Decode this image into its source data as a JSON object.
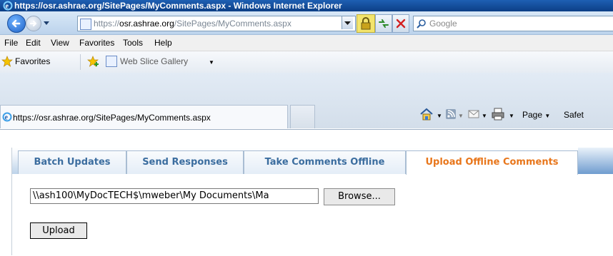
{
  "window": {
    "title": "https://osr.ashrae.org/SitePages/MyComments.aspx - Windows Internet Explorer"
  },
  "address_bar": {
    "url_prefix": "https://",
    "url_domain": "osr.ashrae.org",
    "url_path": "/SitePages/MyComments.aspx"
  },
  "search": {
    "placeholder": "Google"
  },
  "menu": {
    "items": [
      {
        "label": "File"
      },
      {
        "label": "Edit"
      },
      {
        "label": "View"
      },
      {
        "label": "Favorites"
      },
      {
        "label": "Tools"
      },
      {
        "label": "Help"
      }
    ]
  },
  "favorites_bar": {
    "favorites_label": "Favorites",
    "web_slice_label": "Web Slice Gallery"
  },
  "browser_tab": {
    "title": "https://osr.ashrae.org/SitePages/MyComments.aspx"
  },
  "command_bar": {
    "page_label": "Page",
    "safety_label": "Safet"
  },
  "page": {
    "tabs": [
      {
        "label": "Batch Updates",
        "selected": false
      },
      {
        "label": "Send Responses",
        "selected": false
      },
      {
        "label": "Take Comments Offline",
        "selected": false
      },
      {
        "label": "Upload Offline Comments",
        "selected": true
      }
    ],
    "file_path": "\\\\ash100\\MyDocTECH$\\mweber\\My Documents\\Ma",
    "browse_label": "Browse...",
    "upload_label": "Upload"
  },
  "colors": {
    "tab_text": "#3b6d9f",
    "selected_tab_text": "#e8761b",
    "title_bar": "#1e5fb3"
  }
}
